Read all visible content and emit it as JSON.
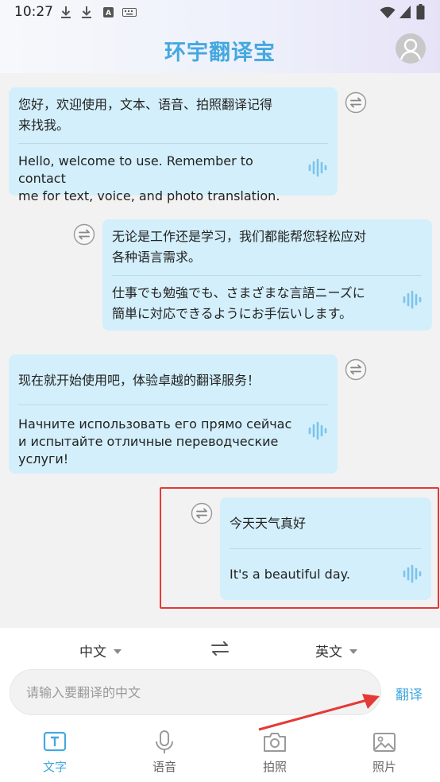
{
  "status_bar": {
    "time": "10:27"
  },
  "header": {
    "title": "环宇翻译宝"
  },
  "messages": [
    {
      "source": "您好，欢迎使用，文本、语音、拍照翻译记得\n来找我。",
      "translation": "Hello, welcome to use. Remember to contact\nme for text, voice, and photo translation."
    },
    {
      "source": "无论是工作还是学习，我们都能帮您轻松应对\n各种语言需求。",
      "translation": "仕事でも勉強でも、さまざまな言語ニーズに\n簡単に対応できるようにお手伝いします。"
    },
    {
      "source": "现在就开始使用吧，体验卓越的翻译服务！",
      "translation": "Начните использовать его прямо сейчас\nи испытайте отличные переводческие\nуслуги!"
    },
    {
      "source": "今天天气真好",
      "translation": "It's a beautiful day."
    }
  ],
  "language_bar": {
    "source_lang": "中文",
    "target_lang": "英文"
  },
  "input": {
    "placeholder": "请输入要翻译的中文",
    "value": ""
  },
  "translate_button": "翻译",
  "tabs": [
    {
      "label": "文字",
      "icon": "text-icon",
      "active": true
    },
    {
      "label": "语音",
      "icon": "microphone-icon",
      "active": false
    },
    {
      "label": "拍照",
      "icon": "camera-icon",
      "active": false
    },
    {
      "label": "照片",
      "icon": "image-icon",
      "active": false
    }
  ],
  "colors": {
    "accent": "#44a8e0",
    "bubble": "#d3effb",
    "highlight": "#e53935",
    "arrow": "#e53935"
  }
}
